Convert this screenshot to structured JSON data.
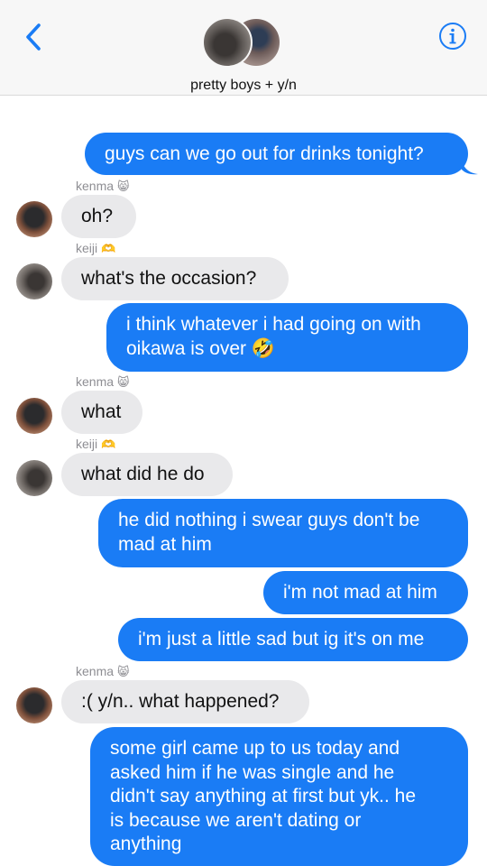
{
  "header": {
    "group_name": "pretty boys + y/n",
    "back_icon": "chevron-left-icon",
    "info_icon": "info-icon",
    "accent": "#1a7cf5"
  },
  "messages": [
    {
      "from": "me",
      "text": "guys can we go out for drinks tonight?"
    },
    {
      "sender": "kenma",
      "sender_emoji": "😸",
      "text": "oh?"
    },
    {
      "sender": "keiji",
      "sender_emoji": "🫶",
      "text": "what's the occasion?"
    },
    {
      "from": "me",
      "text": "i think whatever i had going on with\noikawa is over 🤣"
    },
    {
      "sender": "kenma",
      "sender_emoji": "😸",
      "text": "what"
    },
    {
      "sender": "keiji",
      "sender_emoji": "🫶",
      "text": "what did he do"
    },
    {
      "from": "me",
      "text": "he did nothing i swear guys don't be\nmad at him"
    },
    {
      "from": "me",
      "text": "i'm not mad at him"
    },
    {
      "from": "me",
      "text": "i'm just a little sad but ig it's on me"
    },
    {
      "sender": "kenma",
      "sender_emoji": "😸",
      "text": ":( y/n.. what happened?"
    },
    {
      "from": "me",
      "text": "some girl came up to us today and\nasked him if he was single and he\ndidn't say anything at first but yk.. he\nis because we aren't dating or\nanything"
    }
  ],
  "colors": {
    "outgoing_bubble": "#1a7cf5",
    "incoming_bubble": "#e9e9eb",
    "sender_label": "#8e8e93"
  }
}
